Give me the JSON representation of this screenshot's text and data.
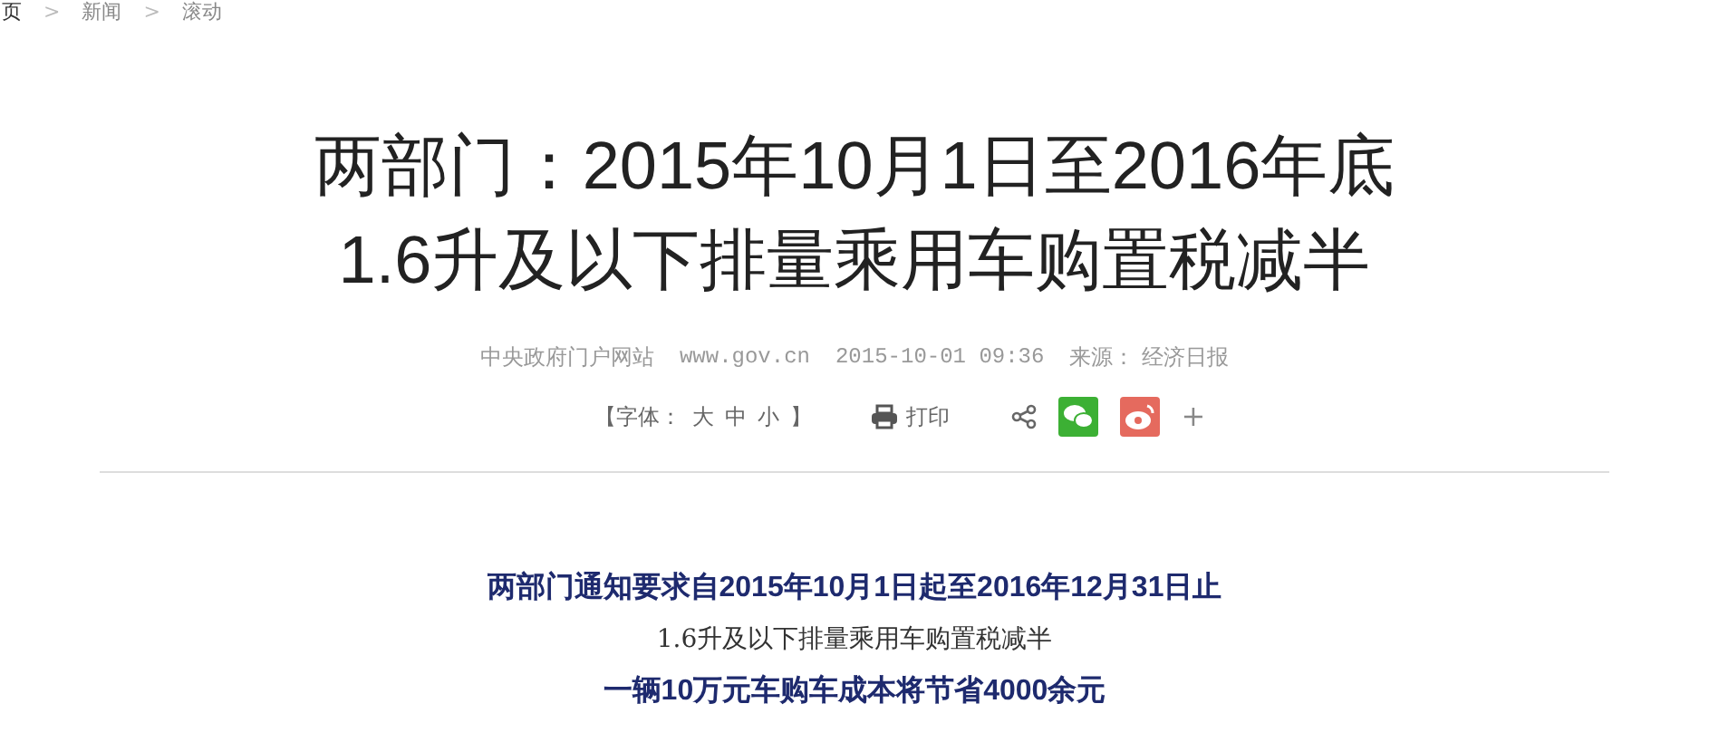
{
  "breadcrumb": {
    "items": [
      "页",
      "新闻",
      "滚动"
    ],
    "separator": ">"
  },
  "title": [
    "两部门：2015年10月1日至2016年底",
    "1.6升及以下排量乘用车购置税减半"
  ],
  "meta": {
    "site": "中央政府门户网站",
    "url": "www.gov.cn",
    "datetime": "2015-10-01 09:36",
    "source_label": "来源：",
    "source": "经济日报"
  },
  "tools": {
    "font_open": "【字体：",
    "font_sizes": [
      "大",
      "中",
      "小"
    ],
    "font_close": "】",
    "print": "打印",
    "more": "+"
  },
  "body": [
    {
      "kind": "bold",
      "text": "两部门通知要求自2015年10月1日起至2016年12月31日止"
    },
    {
      "kind": "plain",
      "text": "1.6升及以下排量乘用车购置税减半"
    },
    {
      "kind": "bold",
      "text": "一辆10万元车购车成本将节省4000余元"
    }
  ]
}
